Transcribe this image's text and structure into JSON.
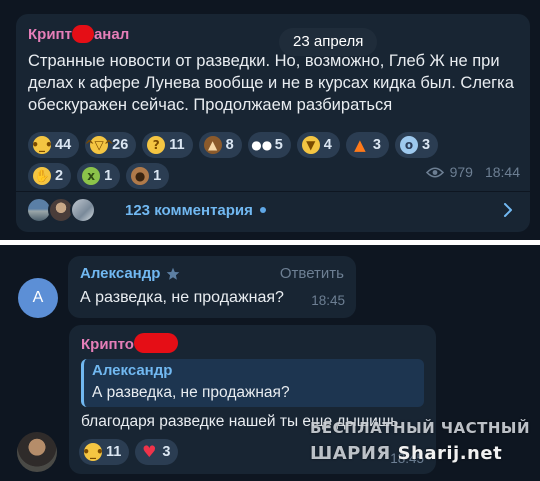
{
  "post": {
    "date": "23 апреля",
    "sender_start": "Крипт",
    "sender_end": "анал",
    "text": "Странные новости от разведки. Но, возможно, Глеб Ж не при делах к афере Лунева вообще и не в курсах кидка был. Слегка обескуражен сейчас. Продолжаем разбираться",
    "reactions_row1": [
      {
        "icon": "neutral-face-icon",
        "glyph": "😐",
        "count": "44"
      },
      {
        "icon": "rofl-face-icon",
        "glyph": "🤣",
        "count": "26"
      },
      {
        "icon": "thinking-face-icon",
        "glyph": "🤔",
        "count": "11"
      },
      {
        "icon": "poop-icon",
        "glyph": "💩",
        "count": "8"
      },
      {
        "icon": "eyes-icon",
        "glyph": "👀",
        "count": "5"
      },
      {
        "icon": "thumbs-down-icon",
        "glyph": "👎",
        "count": "4"
      },
      {
        "icon": "fire-icon",
        "glyph": "🔥",
        "count": "3"
      },
      {
        "icon": "fearful-face-icon",
        "glyph": "😨",
        "count": "3"
      }
    ],
    "reactions_row2": [
      {
        "icon": "handshake-icon",
        "glyph": "🤝",
        "count": "2"
      },
      {
        "icon": "nauseated-face-icon",
        "glyph": "🤮",
        "count": "1"
      },
      {
        "icon": "see-no-evil-monkey-icon",
        "glyph": "🙈",
        "count": "1"
      }
    ],
    "views": "979",
    "time": "18:44",
    "comments_label": "123 комментария"
  },
  "comment1": {
    "avatar_letter": "А",
    "author": "Александр",
    "reply_label": "Ответить",
    "text": "А разведка, не продажная?",
    "time": "18:45"
  },
  "comment2": {
    "author_start": "Крипто",
    "quote_author": "Александр",
    "quote_text": "А разведка, не продажная?",
    "text": "благодаря разведке нашей ты еще дышишь",
    "reactions": [
      {
        "icon": "neutral-face-icon",
        "glyph": "😐",
        "count": "11"
      },
      {
        "icon": "heart-icon",
        "glyph": "♥",
        "count": "3"
      }
    ],
    "time": "18:45"
  },
  "watermark": {
    "line1": "БЕСПЛАТНЫЙ ЧАСТНЫЙ",
    "line2_word": "ШАРИЯ",
    "line2_site": "Sharij.net"
  },
  "colors": {
    "background": "#0e1621",
    "bubble": "#182533",
    "channel_name": "#e57eb8",
    "link_blue": "#71b8f1",
    "redaction": "#e50e16"
  }
}
